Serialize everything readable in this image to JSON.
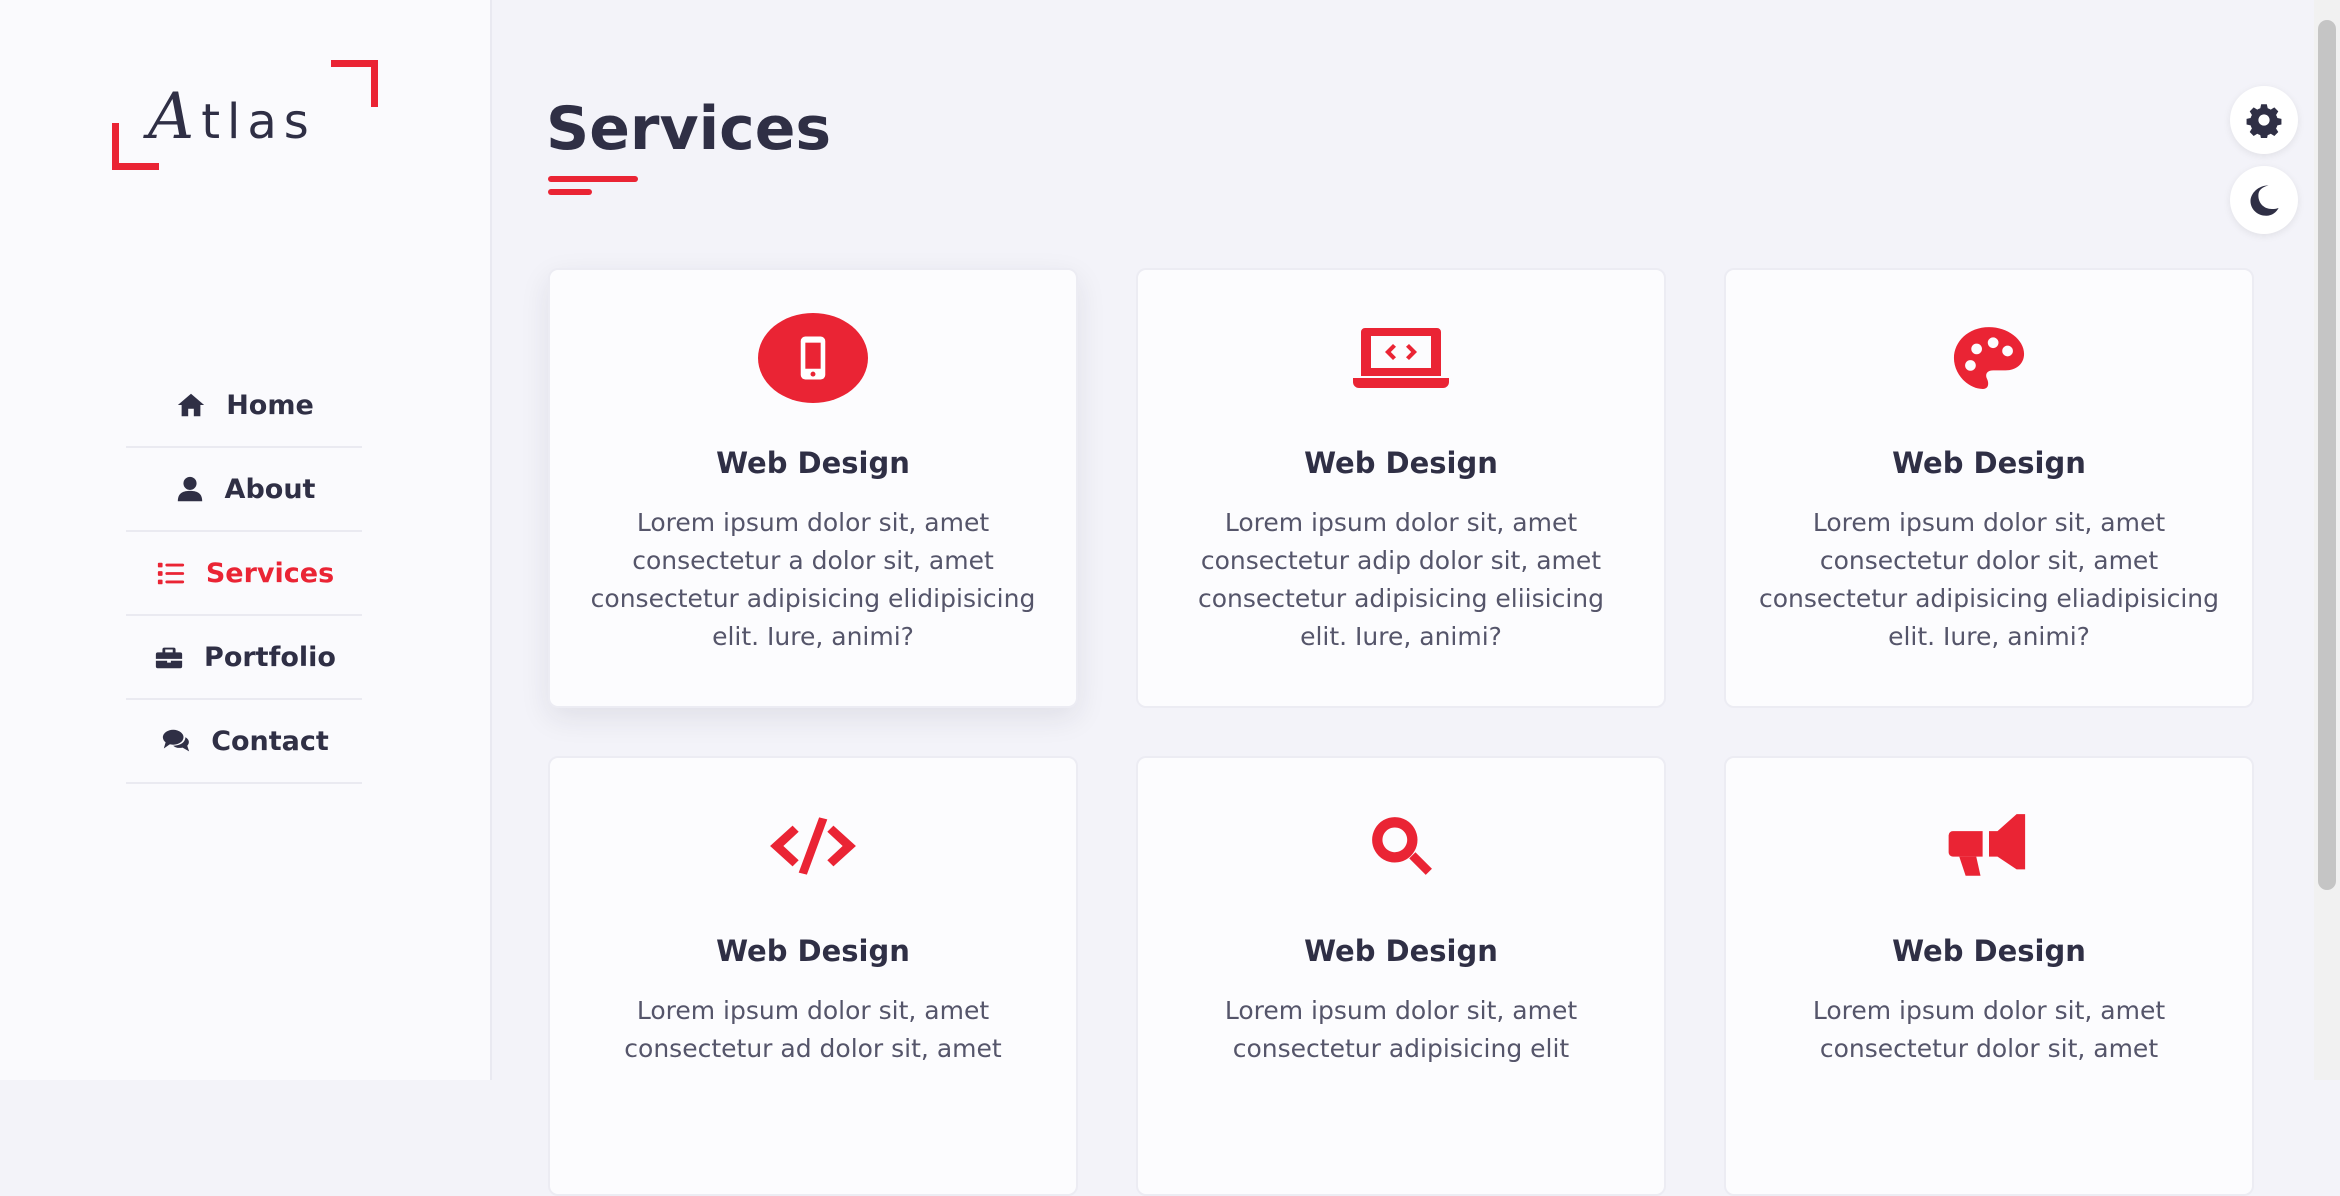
{
  "logo": {
    "initial": "A",
    "rest": "tlas"
  },
  "nav": {
    "items": [
      {
        "label": "Home",
        "icon": "home-icon"
      },
      {
        "label": "About",
        "icon": "user-icon"
      },
      {
        "label": "Services",
        "icon": "list-icon",
        "active": true
      },
      {
        "label": "Portfolio",
        "icon": "briefcase-icon"
      },
      {
        "label": "Contact",
        "icon": "comments-icon"
      }
    ]
  },
  "page": {
    "title": "Services"
  },
  "tools": {
    "settings_icon": "gear-icon",
    "theme_icon": "moon-icon"
  },
  "services": [
    {
      "icon": "mobile-icon",
      "title": "Web Design",
      "text": "Lorem ipsum dolor sit, amet consectetur a dolor sit, amet consectetur adipisicing elidipisicing elit. Iure, animi?"
    },
    {
      "icon": "laptop-code-icon",
      "title": "Web Design",
      "text": "Lorem ipsum dolor sit, amet consectetur adip dolor sit, amet consectetur adipisicing eliisicing elit. Iure, animi?"
    },
    {
      "icon": "palette-icon",
      "title": "Web Design",
      "text": "Lorem ipsum dolor sit, amet consectetur dolor sit, amet consectetur adipisicing eliadipisicing elit. Iure, animi?"
    },
    {
      "icon": "code-icon",
      "title": "Web Design",
      "text": "Lorem ipsum dolor sit, amet consectetur ad dolor sit, amet"
    },
    {
      "icon": "search-icon",
      "title": "Web Design",
      "text": "Lorem ipsum dolor sit, amet consectetur adipisicing elit"
    },
    {
      "icon": "megaphone-icon",
      "title": "Web Design",
      "text": "Lorem ipsum dolor sit, amet consectetur dolor sit, amet"
    }
  ],
  "colors": {
    "accent": "#ea2434",
    "text": "#2f2f45",
    "background": "#f3f3f9"
  }
}
